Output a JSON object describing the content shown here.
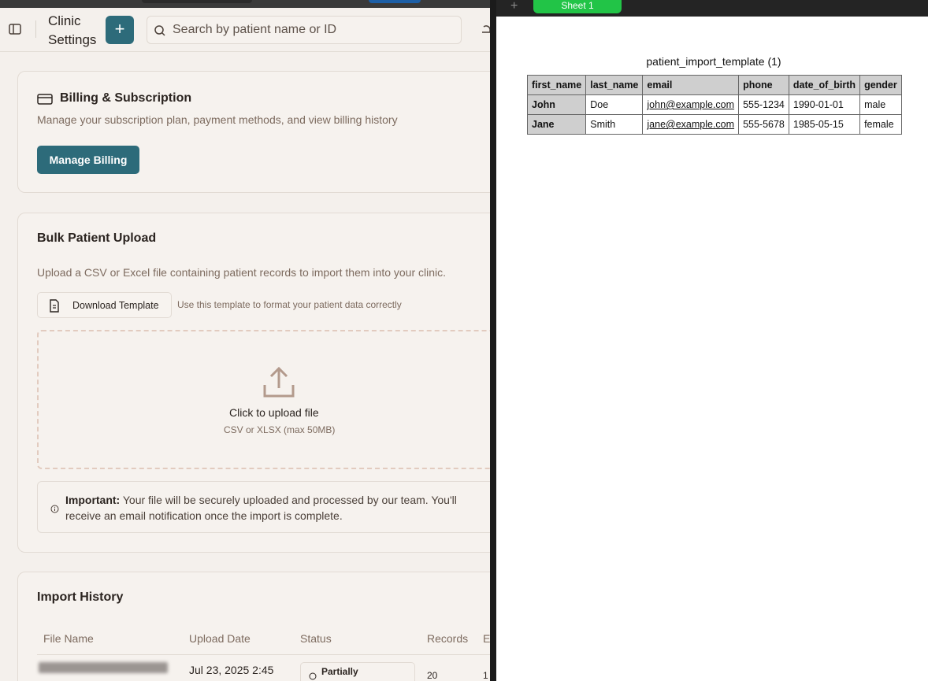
{
  "app": {
    "title": "Clinic Settings",
    "add_button": "+",
    "search_placeholder": "Search by patient name or ID"
  },
  "billing": {
    "title": "Billing & Subscription",
    "description": "Manage your subscription plan, payment methods, and view billing history",
    "button": "Manage Billing"
  },
  "upload": {
    "title": "Bulk Patient Upload",
    "description": "Upload a CSV or Excel file containing patient records to import them into your clinic.",
    "download_button": "Download Template",
    "template_hint": "Use this template to format your patient data correctly",
    "dropzone_cta": "Click to upload file",
    "dropzone_limit": "CSV or XLSX (max 50MB)",
    "important_label": "Important:",
    "important_text": "Your file will be securely uploaded and processed by our team. You'll receive an email notification once the import is complete."
  },
  "history": {
    "title": "Import History",
    "columns": [
      "File Name",
      "Upload Date",
      "Status",
      "Records",
      "E"
    ],
    "rows": [
      {
        "upload_date": "Jul 23, 2025 2:45",
        "status": "Partially",
        "records": "20",
        "extra": "1"
      }
    ]
  },
  "spreadsheet": {
    "add_sheet": "+",
    "tab": "Sheet 1",
    "title": "patient_import_template (1)",
    "columns": [
      "first_name",
      "last_name",
      "email",
      "phone",
      "date_of_birth",
      "gender"
    ],
    "rows": [
      [
        "John",
        "Doe",
        "john@example.com",
        "555-1234",
        "1990-01-01",
        "male"
      ],
      [
        "Jane",
        "Smith",
        "jane@example.com",
        "555-5678",
        "1985-05-15",
        "female"
      ]
    ]
  },
  "colors": {
    "primary": "#2d6b7a",
    "background": "#f4f0ec",
    "sheet_tab": "#22c447"
  },
  "icons": [
    "sidebar-toggle-icon",
    "search-icon",
    "bell-icon",
    "credit-card-icon",
    "document-icon",
    "upload-icon",
    "info-icon",
    "clock-icon"
  ]
}
